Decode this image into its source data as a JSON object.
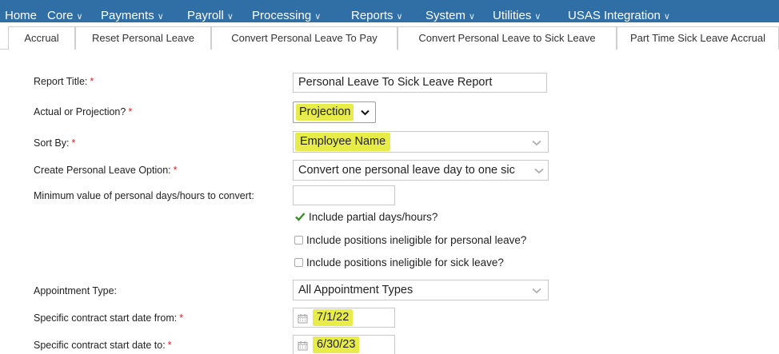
{
  "topnav": {
    "items": [
      {
        "label": "Home",
        "dropdown": false
      },
      {
        "label": "Core",
        "dropdown": true
      },
      {
        "label": "Payments",
        "dropdown": true
      },
      {
        "label": "Payroll",
        "dropdown": true
      },
      {
        "label": "Processing",
        "dropdown": true
      },
      {
        "label": "Reports",
        "dropdown": true
      },
      {
        "label": "System",
        "dropdown": true
      },
      {
        "label": "Utilities",
        "dropdown": true
      },
      {
        "label": "USAS Integration",
        "dropdown": true
      }
    ],
    "chevron": "∨"
  },
  "tabs": [
    {
      "label": "Accrual"
    },
    {
      "label": "Reset Personal Leave"
    },
    {
      "label": "Convert Personal Leave To Pay"
    },
    {
      "label": "Convert Personal Leave to Sick Leave",
      "active": true
    },
    {
      "label": "Part Time Sick Leave Accrual"
    }
  ],
  "form": {
    "report_title": {
      "label": "Report Title:",
      "required": "*",
      "value": "Personal Leave To Sick Leave Report"
    },
    "actual_or_projection": {
      "label": "Actual or Projection?",
      "required": "*",
      "value": "Projection"
    },
    "sort_by": {
      "label": "Sort By:",
      "required": "*",
      "value": "Employee Name"
    },
    "create_option": {
      "label": "Create Personal Leave Option:",
      "required": "*",
      "value": "Convert one personal leave day to one sic"
    },
    "minimum_value": {
      "label": "Minimum value of personal days/hours to convert:",
      "value": ""
    },
    "checkboxes": [
      {
        "label": "Include partial days/hours?",
        "checked": true
      },
      {
        "label": "Include positions ineligible for personal leave?",
        "checked": false
      },
      {
        "label": "Include positions ineligible for sick leave?",
        "checked": false
      }
    ],
    "appointment_type": {
      "label": "Appointment Type:",
      "value": "All Appointment Types"
    },
    "start_from": {
      "label": "Specific contract start date from:",
      "required": "*",
      "value": "7/1/22"
    },
    "start_to": {
      "label": "Specific contract start date to:",
      "required": "*",
      "value": "6/30/23"
    }
  },
  "colors": {
    "nav_bg": "#2f6fa6",
    "highlight": "#e8ec4a",
    "required": "#d62020",
    "check_green": "#3a8f2a"
  },
  "icons": {
    "dropdown": "chevron-down-icon",
    "calendar": "calendar-icon",
    "check": "check-icon"
  }
}
